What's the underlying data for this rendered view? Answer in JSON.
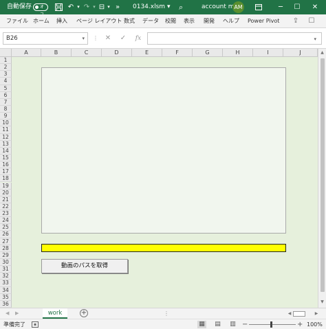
{
  "titlebar": {
    "autosave_label": "自動保存",
    "autosave_state": "オフ",
    "filename": "0134.xlsm",
    "filename_caret": "▾",
    "account_name": "account ms",
    "avatar_initials": "AM"
  },
  "ribbon": {
    "tabs": [
      "ファイル",
      "ホーム",
      "挿入",
      "ページ レイアウト",
      "数式",
      "データ",
      "校閲",
      "表示",
      "開発",
      "ヘルプ",
      "Power Pivot"
    ]
  },
  "formula_bar": {
    "name_box": "B26",
    "cancel_symbol": "✕",
    "enter_symbol": "✓",
    "fx_symbol": "fx",
    "formula_value": ""
  },
  "grid": {
    "columns": [
      "A",
      "B",
      "C",
      "D",
      "E",
      "F",
      "G",
      "H",
      "I",
      "J"
    ],
    "rows": [
      "1",
      "2",
      "3",
      "4",
      "5",
      "6",
      "7",
      "8",
      "9",
      "10",
      "11",
      "12",
      "13",
      "14",
      "15",
      "16",
      "17",
      "18",
      "19",
      "20",
      "21",
      "22",
      "23",
      "24",
      "25",
      "26",
      "27",
      "28",
      "29",
      "30",
      "31",
      "32",
      "33",
      "34",
      "35",
      "36"
    ]
  },
  "sheet_objects": {
    "path_display_value": "",
    "get_path_button_label": "動画のパスを取得"
  },
  "sheet_tabs": {
    "tabs": [
      "work"
    ],
    "add_symbol": "+",
    "more_symbol": "⋮"
  },
  "status": {
    "ready_text": "準備完了",
    "zoom_level": "100%"
  },
  "colors": {
    "title_green": "#217346",
    "sheet_background": "#e6f0dc",
    "highlight_yellow": "#ffff00"
  }
}
